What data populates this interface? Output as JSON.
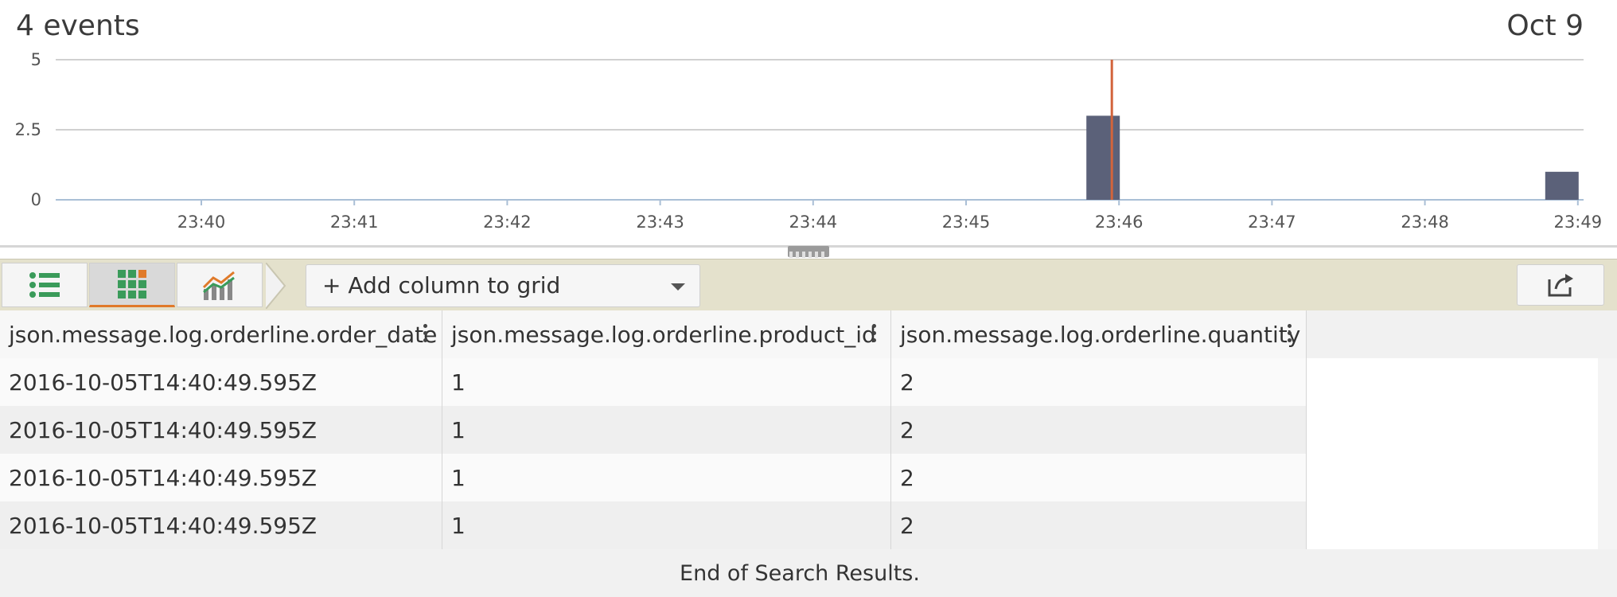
{
  "header": {
    "events_count": "4 events",
    "date_label": "Oct 9"
  },
  "chart_data": {
    "type": "bar",
    "title": "",
    "y_ticks": [
      "5",
      "2.5",
      "0"
    ],
    "ylim": [
      0,
      5
    ],
    "x_ticks": [
      "23:40",
      "23:41",
      "23:42",
      "23:43",
      "23:44",
      "23:45",
      "23:46",
      "23:47",
      "23:48",
      "23:49"
    ],
    "bars": [
      {
        "x": "23:46",
        "value": 3
      },
      {
        "x": "23:49",
        "value": 1
      }
    ],
    "marker_x": "23:46",
    "colors": {
      "bar": "#5b6179",
      "marker": "#d2643c",
      "grid": "#d0d0d0"
    }
  },
  "toolbar": {
    "views": [
      {
        "name": "list-view",
        "icon": "list-icon"
      },
      {
        "name": "grid-view",
        "icon": "grid-icon",
        "active": true
      },
      {
        "name": "chart-view",
        "icon": "chart-icon"
      }
    ],
    "add_column_label": "+ Add column to grid",
    "share_icon": "share-icon"
  },
  "grid": {
    "columns": [
      "json.message.log.orderline.order_date",
      "json.message.log.orderline.product_id",
      "json.message.log.orderline.quantity"
    ],
    "rows": [
      [
        "2016-10-05T14:40:49.595Z",
        "1",
        "2"
      ],
      [
        "2016-10-05T14:40:49.595Z",
        "1",
        "2"
      ],
      [
        "2016-10-05T14:40:49.595Z",
        "1",
        "2"
      ],
      [
        "2016-10-05T14:40:49.595Z",
        "1",
        "2"
      ]
    ],
    "footer": "End of Search Results."
  }
}
